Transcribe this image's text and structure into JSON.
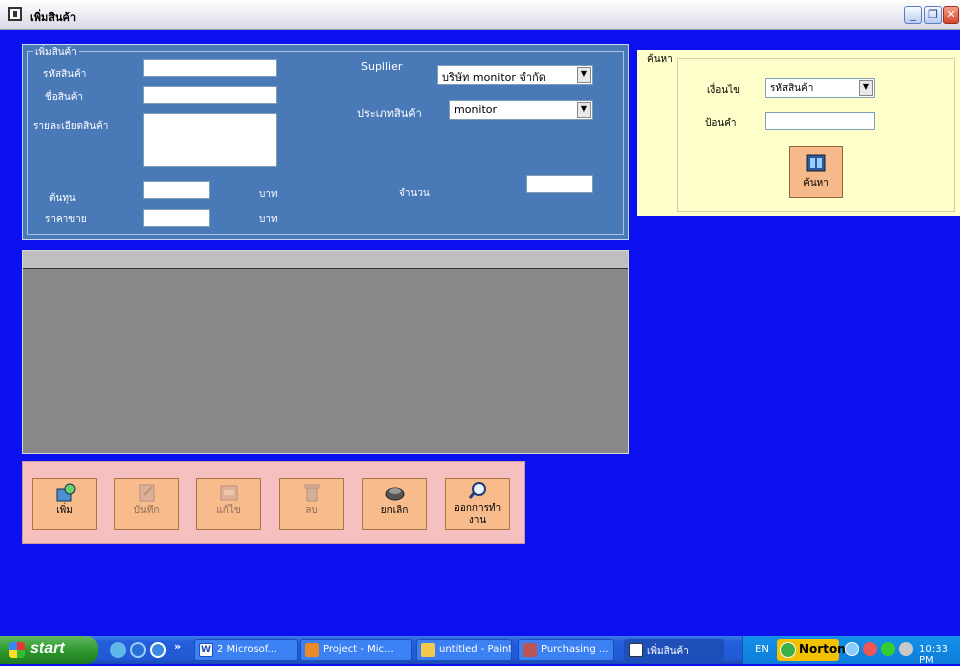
{
  "window": {
    "title": "เพิ่มสินค้า",
    "controls": {
      "minimize": "_",
      "restore": "❐",
      "close": "✕"
    }
  },
  "form": {
    "group_title": "เพิ่มสินค้า",
    "product_id_label": "รหัสสินค้า",
    "product_id_value": "",
    "product_name_label": "ชื่อสินค้า",
    "product_name_value": "",
    "details_label": "รายละเอียดสินค้า",
    "details_value": "",
    "cost_label": "ต้นทุน",
    "cost_value": "",
    "cost_unit": "บาท",
    "price_label": "ราคาขาย",
    "price_value": "",
    "price_unit": "บาท",
    "supplier_label": "Supllier",
    "supplier_value": "บริษัท monitor จำกัด",
    "category_label": "ประเภทสินค้า",
    "category_value": "monitor",
    "quantity_label": "จำนวน",
    "quantity_value": ""
  },
  "search": {
    "group_title": "ค้นหา",
    "condition_label": "เงื่อนไข",
    "condition_value": "รหัสสินค้า",
    "keyword_label": "ป้อนคำ",
    "keyword_value": "",
    "button_label": "ค้นหา"
  },
  "actions": [
    {
      "label": "เพิ่ม",
      "icon": "add-icon",
      "enabled": true
    },
    {
      "label": "บันทึก",
      "icon": "save-icon",
      "enabled": false
    },
    {
      "label": "แก้ไข",
      "icon": "edit-icon",
      "enabled": false
    },
    {
      "label": "ลบ",
      "icon": "delete-icon",
      "enabled": false
    },
    {
      "label": "ยกเลิก",
      "icon": "cancel-icon",
      "enabled": true
    },
    {
      "label": "ออกการทำงาน",
      "label_line1": "ออกการทำ",
      "label_line2": "งาน",
      "icon": "exit-icon",
      "enabled": true
    }
  ],
  "taskbar": {
    "start_label": "start",
    "chevron": "»",
    "tasks": [
      {
        "label": "2 Microsof...",
        "icon": "word-icon"
      },
      {
        "label": "Project - Mic...",
        "icon": "project-icon"
      },
      {
        "label": "untitled - Paint",
        "icon": "paint-icon"
      },
      {
        "label": "Purchasing ...",
        "icon": "access-icon"
      },
      {
        "label": "เพิ่มสินค้า",
        "icon": "form-icon"
      }
    ],
    "tray": {
      "language": "EN",
      "norton": "Norton",
      "clock": "10:33 PM"
    }
  },
  "colors": {
    "desktop": "#0a10f0",
    "form_panel": "#4a79b8",
    "search_panel": "#ffffcc",
    "action_panel": "#f6c0c0",
    "button": "#f7bb8c"
  }
}
